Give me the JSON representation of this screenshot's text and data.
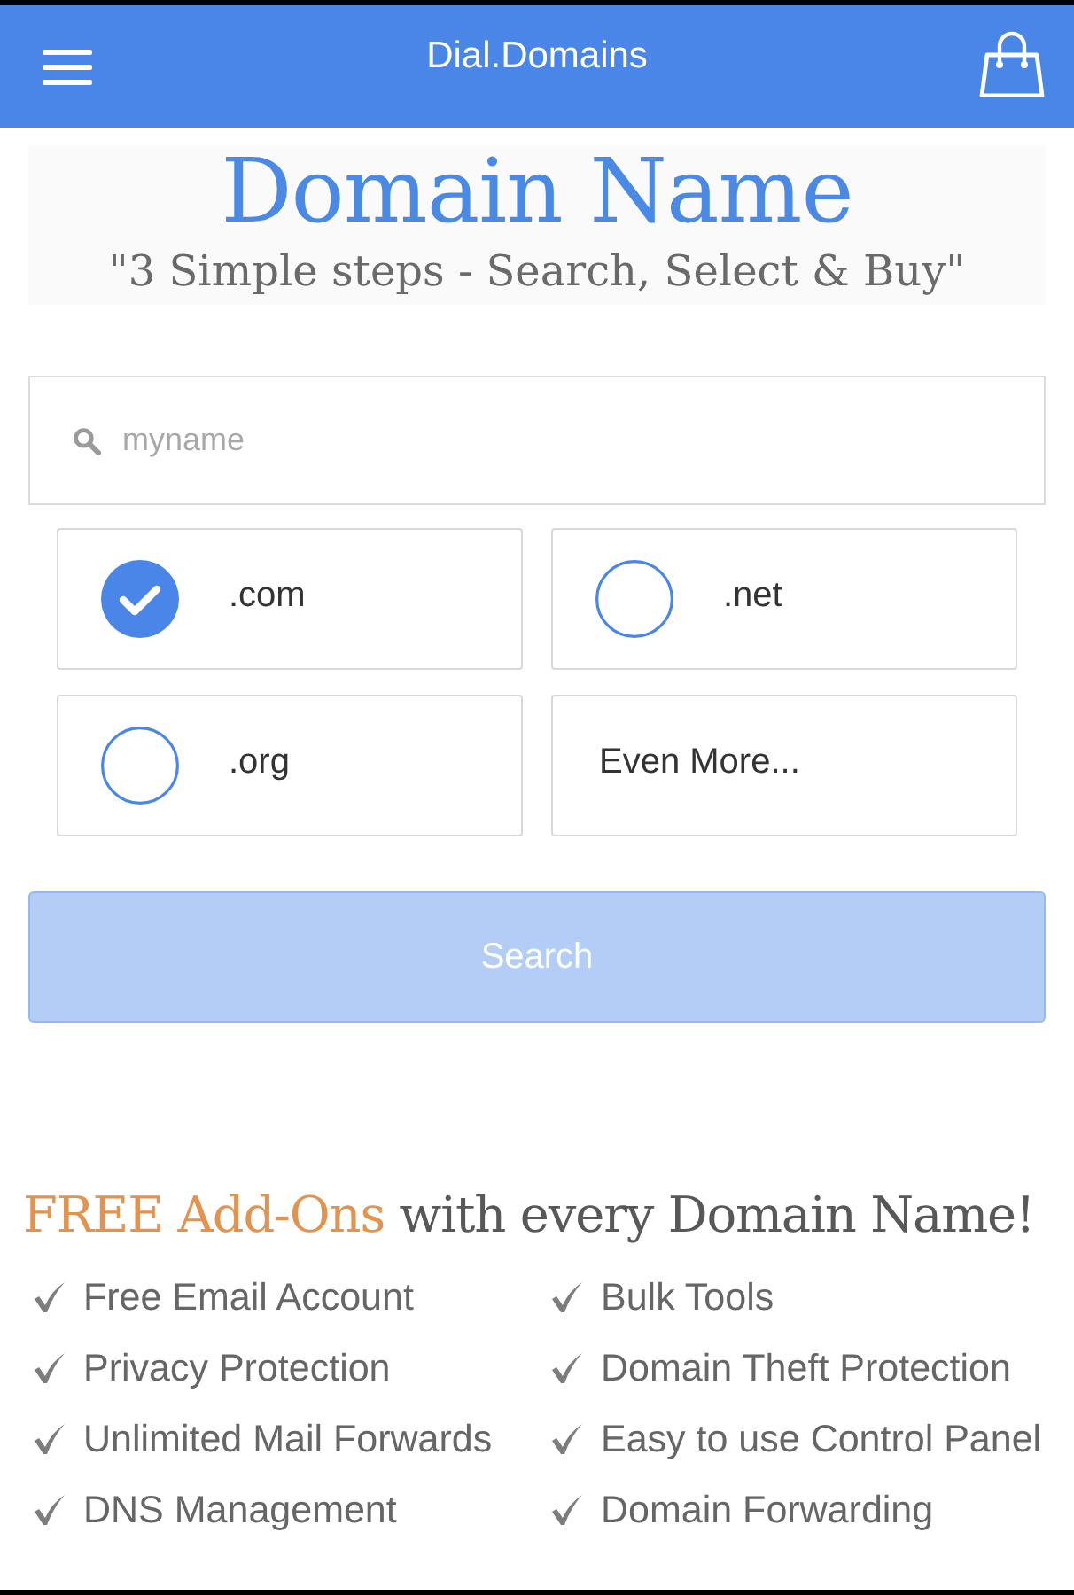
{
  "app_bar": {
    "title": "Dial.Domains"
  },
  "banner": {
    "title": "Domain Name",
    "subtitle": "\"3 Simple steps - Search, Select & Buy\""
  },
  "search": {
    "placeholder": "myname"
  },
  "extensions": [
    {
      "kind": "option",
      "label": ".com",
      "selected": true
    },
    {
      "kind": "option",
      "label": ".net",
      "selected": false
    },
    {
      "kind": "option",
      "label": ".org",
      "selected": false
    },
    {
      "kind": "more",
      "label": "Even More..."
    }
  ],
  "search_button": {
    "label": "Search",
    "disabled": true
  },
  "addons": {
    "heading": {
      "accent": "FREE Add-Ons",
      "rest": "with every Domain Name!"
    },
    "items": [
      "Free Email Account",
      "Bulk Tools",
      "Privacy Protection",
      "Domain Theft Protection",
      "Unlimited Mail Forwards",
      "Easy to use Control Panel",
      "DNS Management",
      "Domain Forwarding"
    ]
  }
}
